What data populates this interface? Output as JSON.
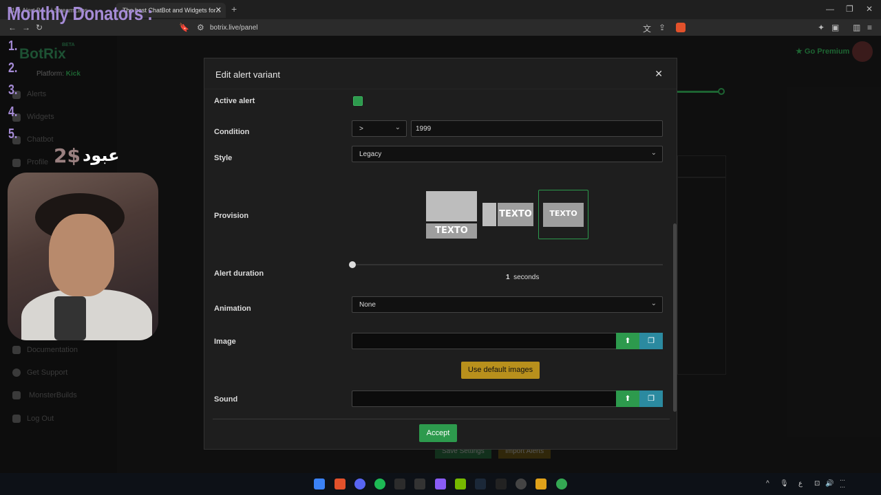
{
  "browser": {
    "tabs": [
      {
        "title": "(17) Alert Bo... | StreamLabs"
      },
      {
        "title": "The best ChatBot and Widgets for..."
      }
    ],
    "new_tab_icon": "plus-icon",
    "url": "botrix.live/panel"
  },
  "stream_overlay": {
    "title": "Monthly Donators :",
    "ranks": [
      "1.",
      "2.",
      "3.",
      "4.",
      "5."
    ],
    "top_donor": {
      "name": "عبود",
      "amount": "2$"
    }
  },
  "app": {
    "logo": "BotRix",
    "beta_badge": "BETA",
    "platform_label": "Platform:",
    "platform_value": "Kick",
    "premium_label": "Go Premium",
    "nav": [
      "Alerts",
      "Widgets",
      "Chatbot",
      "Profile",
      "Documentation",
      "Get Support",
      "MonsterBuilds",
      "Log Out"
    ],
    "bg_buttons": [
      "Save Settings",
      "Import Alerts"
    ]
  },
  "modal": {
    "title": "Edit alert variant",
    "close_icon": "close-icon",
    "active_alert_label": "Active alert",
    "active_alert_checked": true,
    "condition_label": "Condition",
    "condition_operator": ">",
    "condition_value": "1999",
    "style_label": "Style",
    "style_value": "Legacy",
    "provision_label": "Provision",
    "provision_text": "TEXTO",
    "provision_selected_index": 2,
    "alert_duration_label": "Alert duration",
    "duration_value": "1",
    "duration_unit": "seconds",
    "animation_label": "Animation",
    "animation_value": "None",
    "image_label": "Image",
    "image_value": "",
    "use_default_images": "Use default images",
    "sound_label": "Sound",
    "sound_value": "",
    "accept_label": "Accept"
  },
  "colors": {
    "accent": "#2d9a4d",
    "library": "#2b8aa0",
    "default_images": "#b8901c",
    "overlay_purple": "#a58bd6"
  }
}
